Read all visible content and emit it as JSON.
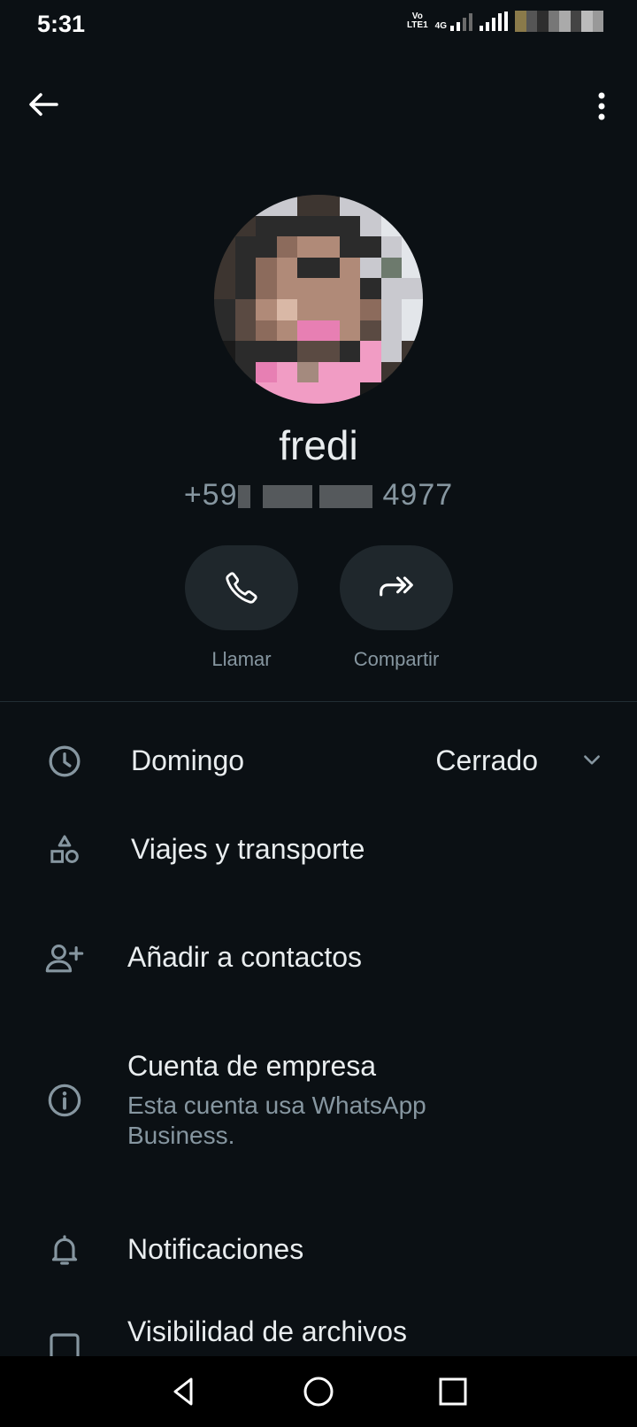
{
  "status_bar": {
    "time": "5:31",
    "network_top": "Vo",
    "network_bottom": "LTE1",
    "network_type": "4G"
  },
  "contact": {
    "name": "fredi",
    "phone_prefix": "+59",
    "phone_suffix": "4977"
  },
  "actions": {
    "call_label": "Llamar",
    "share_label": "Compartir"
  },
  "details": {
    "hours_day": "Domingo",
    "hours_status": "Cerrado",
    "category": "Viajes y transporte",
    "add_contact": "Añadir a contactos",
    "business_title": "Cuenta de empresa",
    "business_subtitle": "Esta cuenta usa WhatsApp Business.",
    "notifications": "Notificaciones",
    "media_visibility": "Visibilidad de archivos"
  },
  "icons": {
    "back": "arrow-left-icon",
    "menu": "more-vert-icon",
    "call": "phone-icon",
    "share": "forward-icon",
    "hours": "clock-icon",
    "category": "shapes-icon",
    "add_contact": "person-add-icon",
    "business": "info-icon",
    "notifications": "bell-icon",
    "media": "image-icon"
  },
  "colors": {
    "background": "#0b1014",
    "primary_text": "#e9edef",
    "secondary_text": "#8696a0",
    "button_bg": "#1f272c"
  }
}
